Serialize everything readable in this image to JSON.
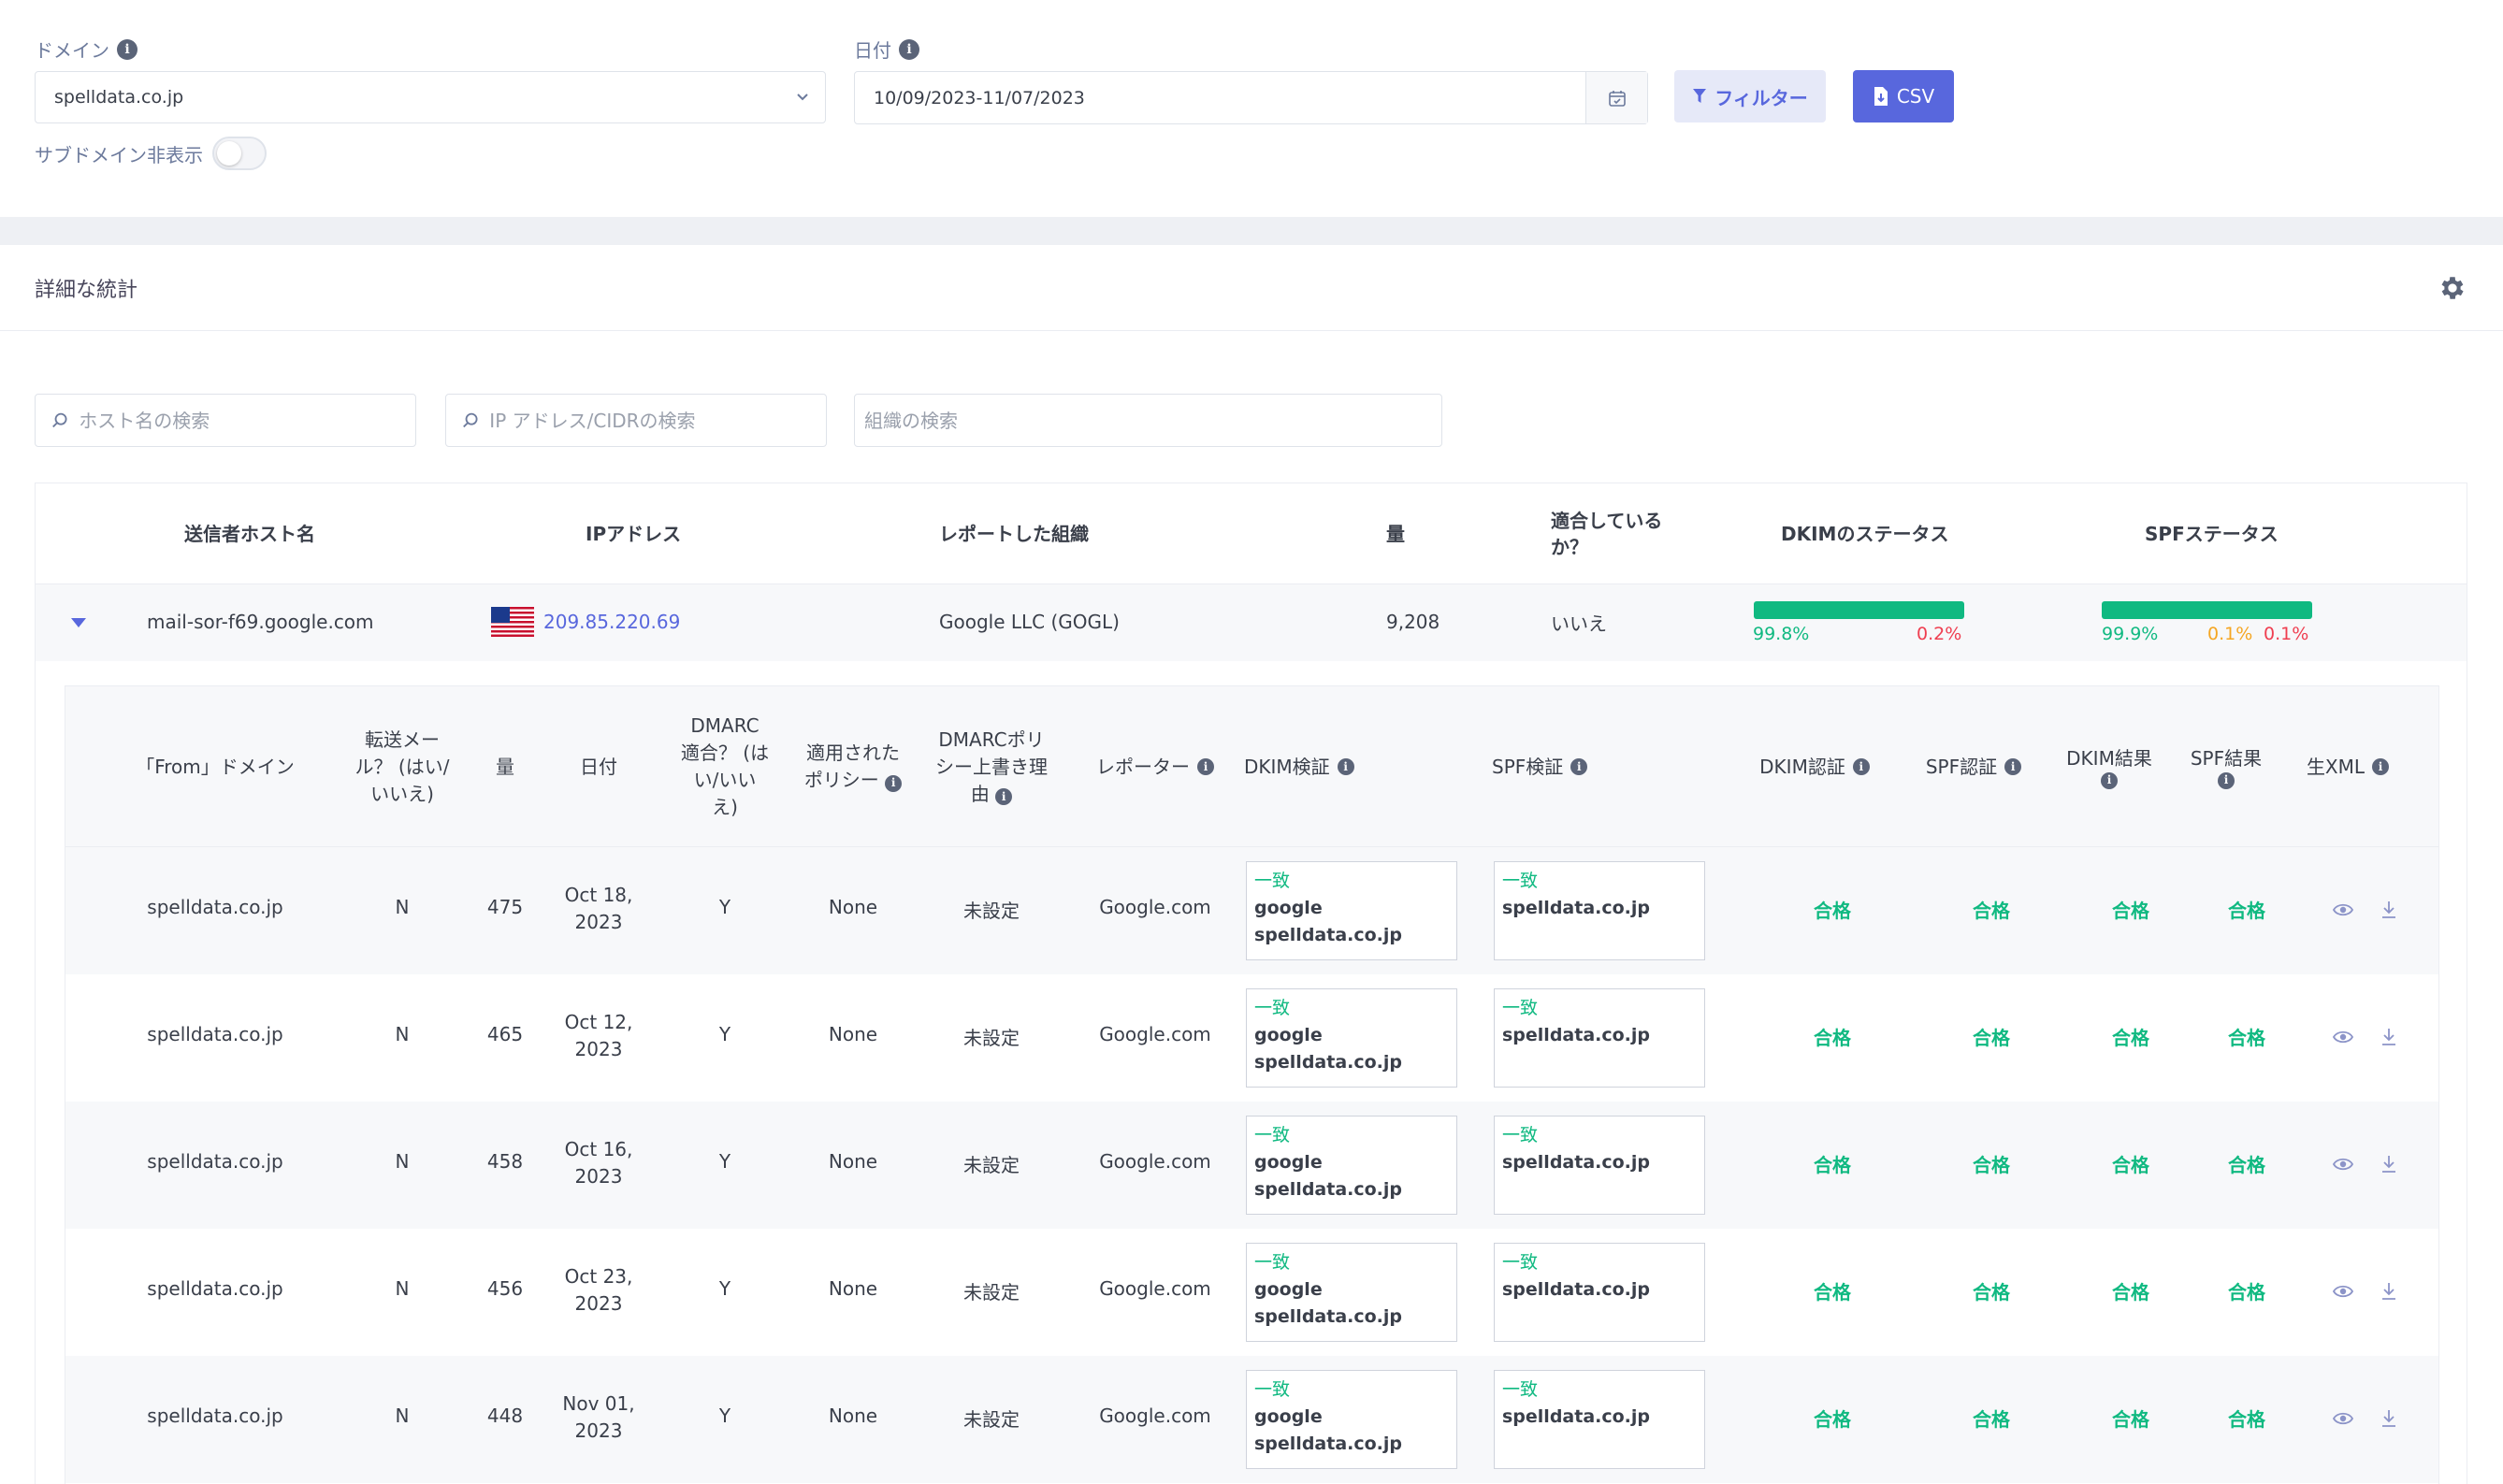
{
  "filters": {
    "domain_label": "ドメイン",
    "domain_value": "spelldata.co.jp",
    "date_label": "日付",
    "date_value": "10/09/2023-11/07/2023",
    "filter_btn": "フィルター",
    "csv_btn": "CSV",
    "subdomain_label": "サブドメイン非表示"
  },
  "stats": {
    "title": "詳細な統計",
    "search_host_placeholder": "ホスト名の検索",
    "search_ip_placeholder": "IP アドレス/CIDRの検索",
    "search_org_placeholder": "組織の検索"
  },
  "main_table": {
    "headers": {
      "host": "送信者ホスト名",
      "ip": "IPアドレス",
      "org": "レポートした組織",
      "volume": "量",
      "compliant_1": "適合している",
      "compliant_2": "か？",
      "dkim_status": "DKIMのステータス",
      "spf_status": "SPFステータス"
    },
    "row": {
      "host": "mail-sor-f69.google.com",
      "ip": "209.85.220.69",
      "org": "Google LLC (GOGL)",
      "volume": "9,208",
      "compliant": "いいえ",
      "dkim_pass": "99.8%",
      "dkim_fail": "0.2%",
      "spf_pass": "99.9%",
      "spf_neutral": "0.1%",
      "spf_fail": "0.1%"
    }
  },
  "nested_table": {
    "headers": {
      "from_domain": "「From」ドメイン",
      "fwd_1": "転送メー",
      "fwd_2": "ル？ (はい/",
      "fwd_3": "いいえ)",
      "volume": "量",
      "date": "日付",
      "dmarc_1": "DMARC",
      "dmarc_2": "適合？ (は",
      "dmarc_3": "い/いい",
      "dmarc_4": "え)",
      "policy_1": "適用された",
      "policy_2": "ポリシー",
      "override_1": "DMARCポリ",
      "override_2": "シー上書き理",
      "override_3": "由",
      "reporter": "レポーター",
      "dkim_verify": "DKIM検証",
      "spf_verify": "SPF検証",
      "dkim_auth": "DKIM認証",
      "spf_auth": "SPF認証",
      "dkim_result_1": "DKIM結果",
      "spf_result_1": "SPF結果",
      "raw_xml": "生XML"
    },
    "rows": [
      {
        "domain": "spelldata.co.jp",
        "fwd": "N",
        "volume": "475",
        "date_1": "Oct 18,",
        "date_2": "2023",
        "dmarc": "Y",
        "policy": "None",
        "override": "未設定",
        "reporter": "Google.com",
        "dkim_match": "一致",
        "dkim_sel": "google",
        "dkim_dom": "spelldata.co.jp",
        "spf_match": "一致",
        "spf_dom": "spelldata.co.jp",
        "dkim_auth": "合格",
        "spf_auth": "合格",
        "dkim_res": "合格",
        "spf_res": "合格"
      },
      {
        "domain": "spelldata.co.jp",
        "fwd": "N",
        "volume": "465",
        "date_1": "Oct 12,",
        "date_2": "2023",
        "dmarc": "Y",
        "policy": "None",
        "override": "未設定",
        "reporter": "Google.com",
        "dkim_match": "一致",
        "dkim_sel": "google",
        "dkim_dom": "spelldata.co.jp",
        "spf_match": "一致",
        "spf_dom": "spelldata.co.jp",
        "dkim_auth": "合格",
        "spf_auth": "合格",
        "dkim_res": "合格",
        "spf_res": "合格"
      },
      {
        "domain": "spelldata.co.jp",
        "fwd": "N",
        "volume": "458",
        "date_1": "Oct 16,",
        "date_2": "2023",
        "dmarc": "Y",
        "policy": "None",
        "override": "未設定",
        "reporter": "Google.com",
        "dkim_match": "一致",
        "dkim_sel": "google",
        "dkim_dom": "spelldata.co.jp",
        "spf_match": "一致",
        "spf_dom": "spelldata.co.jp",
        "dkim_auth": "合格",
        "spf_auth": "合格",
        "dkim_res": "合格",
        "spf_res": "合格"
      },
      {
        "domain": "spelldata.co.jp",
        "fwd": "N",
        "volume": "456",
        "date_1": "Oct 23,",
        "date_2": "2023",
        "dmarc": "Y",
        "policy": "None",
        "override": "未設定",
        "reporter": "Google.com",
        "dkim_match": "一致",
        "dkim_sel": "google",
        "dkim_dom": "spelldata.co.jp",
        "spf_match": "一致",
        "spf_dom": "spelldata.co.jp",
        "dkim_auth": "合格",
        "spf_auth": "合格",
        "dkim_res": "合格",
        "spf_res": "合格"
      },
      {
        "domain": "spelldata.co.jp",
        "fwd": "N",
        "volume": "448",
        "date_1": "Nov 01,",
        "date_2": "2023",
        "dmarc": "Y",
        "policy": "None",
        "override": "未設定",
        "reporter": "Google.com",
        "dkim_match": "一致",
        "dkim_sel": "google",
        "dkim_dom": "spelldata.co.jp",
        "spf_match": "一致",
        "spf_dom": "spelldata.co.jp",
        "dkim_auth": "合格",
        "spf_auth": "合格",
        "dkim_res": "合格",
        "spf_res": "合格"
      }
    ]
  },
  "icons": {
    "info": "info-icon",
    "chevron": "chevron-down-icon",
    "calendar": "calendar-icon",
    "filter": "filter-icon",
    "file": "file-download-icon",
    "gear": "gear-icon",
    "search": "search-icon",
    "caret": "caret-down-icon",
    "flag": "us-flag-icon",
    "eye": "eye-icon",
    "download": "download-icon"
  },
  "colors": {
    "accent": "#5867dd",
    "pass": "#10b981",
    "neutral": "#f5a623",
    "fail": "#ef3e50"
  }
}
